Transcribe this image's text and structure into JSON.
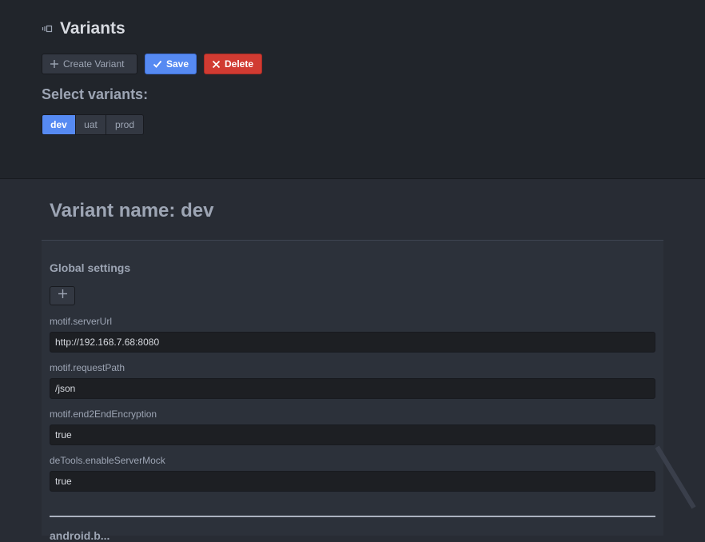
{
  "header": {
    "title": "Variants",
    "title_icon": "panel-icon"
  },
  "toolbar": {
    "create_label": "Create Variant",
    "save_label": "Save",
    "delete_label": "Delete"
  },
  "select_variants": {
    "label": "Select variants:",
    "options": [
      "dev",
      "uat",
      "prod"
    ],
    "selected": "dev"
  },
  "variant": {
    "title": "Variant name: dev"
  },
  "global_settings": {
    "heading": "Global settings",
    "fields": [
      {
        "label": "motif.serverUrl",
        "value": "http://192.168.7.68:8080"
      },
      {
        "label": "motif.requestPath",
        "value": "/json"
      },
      {
        "label": "motif.end2EndEncryption",
        "value": "true"
      },
      {
        "label": "deTools.enableServerMock",
        "value": "true"
      }
    ]
  },
  "next_section": {
    "heading": "android.b..."
  },
  "colors": {
    "accent": "#568af2",
    "danger": "#d13b32",
    "background": "#282c34",
    "header_background": "#21252b"
  }
}
